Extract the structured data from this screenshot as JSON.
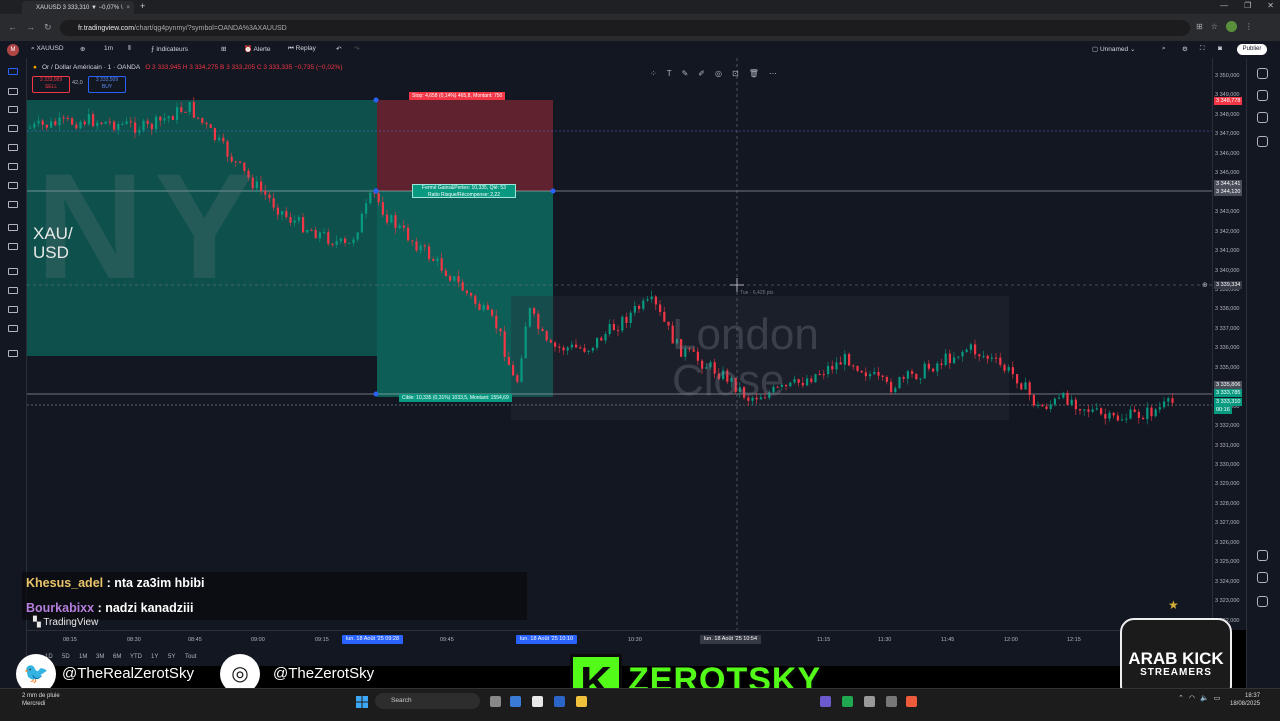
{
  "browser": {
    "tab_title": "XAUUSD 3 333,310 ▼ −0,07% \\",
    "tab_close": "×",
    "new_tab": "+",
    "url_host": "fr.tradingview.com",
    "url_path": "/chart/qg4pynmy/?symbol=OANDA%3AXAUUSD",
    "window_controls": [
      "—",
      "❐",
      "✕"
    ]
  },
  "toolbar": {
    "avatar": "M",
    "symbol": "XAUUSD",
    "interval": "1m",
    "indicators": "Indicateurs",
    "alert": "Alerte",
    "replay": "Replay",
    "layout_name": "Unnamed",
    "publish": "Publier"
  },
  "legend": {
    "title": "Or / Dollar Américain · 1 · OANDA",
    "ohlc": "O 3 333,945  H 3 334,275  B 3 333,205  C 3 333,335  −0,735 (−0,02%)",
    "sell_price": "3 333,089",
    "sell_label": "SELL",
    "spread": "42,0",
    "buy_price": "3 333,509",
    "buy_label": "BUY"
  },
  "drawing_toolbar": {
    "icons": [
      "grid-icon",
      "text-icon",
      "brush-icon",
      "pencil-icon",
      "eye-icon",
      "lock-icon",
      "trash-icon",
      "more-icon"
    ]
  },
  "watermarks": {
    "ny": "NY",
    "symbol_line1": "XAU/",
    "symbol_line2": "USD",
    "london_line1": "London",
    "london_line2": "Close"
  },
  "trade": {
    "stop_label": "Stop: 4,658 (0,14%) 465,8, Montant: 750",
    "closed_line1": "Fermé Gains&Pertes: 10,335, Qté: 53",
    "closed_line2": "Ratio Risque/Récompense: 2,22",
    "target_label": "Cible: 10,335 (0,31%) 1033,5, Montant: 1554,69",
    "crosshair_note": "Tue · 6,425 pts"
  },
  "price_axis": {
    "ticks": [
      "3 350,000",
      "3 349,000",
      "3 348,000",
      "3 347,000",
      "3 346,000",
      "3 345,000",
      "3 344,000",
      "3 343,000",
      "3 342,000",
      "3 341,000",
      "3 340,000",
      "3 339,000",
      "3 338,000",
      "3 337,000",
      "3 336,000",
      "3 335,000",
      "3 334,000",
      "3 333,000",
      "3 332,000",
      "3 331,000",
      "3 330,000",
      "3 329,000",
      "3 328,000",
      "3 327,000",
      "3 326,000",
      "3 325,000",
      "3 324,000",
      "3 323,000",
      "3 322,000"
    ],
    "tag_stop": "3 348,778",
    "tag_entry": "3 344,141",
    "tag_entry2": "3 344,120",
    "tag_crosshair": "3 339,334",
    "tag_current": "3 333,785",
    "tag_current2": "3 333,310",
    "tag_timer": "00:16",
    "tag_target": "3 335,806"
  },
  "time_axis": {
    "ticks": [
      "08:15",
      "08:30",
      "08:45",
      "09:00",
      "09:15",
      "09:45",
      "10:30",
      "11:15",
      "11:30",
      "11:45",
      "12:00",
      "12:15"
    ],
    "sel1": "lun. 18 Août '25  09:28",
    "sel2": "lun. 18 Août '25  10:10",
    "sel3": "lun. 18 Août '25  10:54"
  },
  "bottom_bar": {
    "ranges": [
      "1D",
      "5D",
      "1M",
      "3M",
      "6M",
      "YTD",
      "1Y",
      "5Y",
      "Tout"
    ],
    "brand": "TradingView"
  },
  "chat": [
    {
      "user": "Khesus_adel",
      "message": " : nta za3im hbibi"
    },
    {
      "user": "Bourkabixx",
      "message": " : nadzi kanadziii"
    }
  ],
  "overlays": {
    "twitter_handle": "@TheRealZerotSky",
    "instagram_handle": "@TheZerotSky",
    "brand_k": "K",
    "brand_name": "ZEROTSKY",
    "badge_line1": "ARAB KICK",
    "badge_line2": "STREAMERS"
  },
  "taskbar": {
    "weather_line1": "2 mm de pluie",
    "weather_line2": "Mercredi",
    "search": "Search",
    "time": "18:37",
    "date": "18/08/2025"
  }
}
